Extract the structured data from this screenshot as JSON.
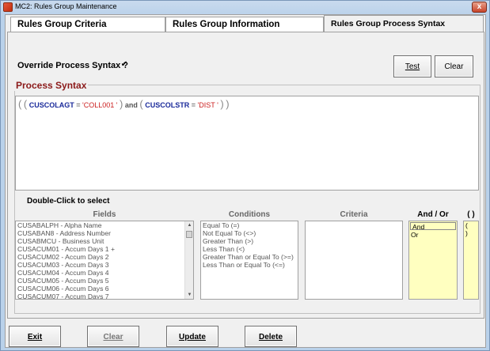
{
  "window": {
    "title": "MC2: Rules Group Maintenance",
    "close_glyph": "x"
  },
  "tabs": [
    {
      "label": "Rules Group Criteria",
      "active": false
    },
    {
      "label": "Rules Group Information",
      "active": false
    },
    {
      "label": "Rules Group Process Syntax",
      "active": true
    }
  ],
  "override": {
    "label": "Override Process Syntax ?",
    "checked": true,
    "check_glyph": "✔"
  },
  "buttons_top": {
    "test_label": "Test",
    "clear_label": "Clear"
  },
  "process_syntax": {
    "title": "Process Syntax",
    "tokens": {
      "open1": "(",
      "open2": "(",
      "field1": "CUSCOLAGT",
      "eq1": "=",
      "val1": "'COLL001 '",
      "close1": ")",
      "and": "and",
      "open3": "(",
      "field2": "CUSCOLSTR",
      "eq2": "=",
      "val2": "'DIST '",
      "close2": ")",
      "close3": ")"
    }
  },
  "select_hint": "Double-Click to select",
  "columns": {
    "fields": "Fields",
    "conditions": "Conditions",
    "criteria": "Criteria",
    "and_or": "And / Or",
    "parens": "( )"
  },
  "fields_list": [
    "CUSABALPH - Alpha Name",
    "CUSABAN8 - Address  Number",
    "CUSABMCU - Business Unit",
    "CUSACUM01 - Accum Days 1 +",
    "CUSACUM02 - Accum Days 2",
    "CUSACUM03 - Accum Days 3",
    "CUSACUM04 - Accum Days 4",
    "CUSACUM05 - Accum Days 5",
    "CUSACUM06 - Accum Days 6",
    "CUSACUM07 - Accum Days 7"
  ],
  "conditions_list": [
    "Equal To (=)",
    "Not Equal To (<>)",
    "Greater Than (>)",
    "Less Than (<)",
    "Greater Than or Equal To (>=)",
    "Less Than or Equal To (<=)"
  ],
  "and_or_list": [
    "And",
    "Or"
  ],
  "parens_list": [
    "(",
    ")"
  ],
  "buttons_bottom": {
    "exit": "Exit",
    "clear": "Clear",
    "update": "Update",
    "delete": "Delete"
  },
  "scroll_up_glyph": "▲",
  "scroll_down_glyph": "▼"
}
